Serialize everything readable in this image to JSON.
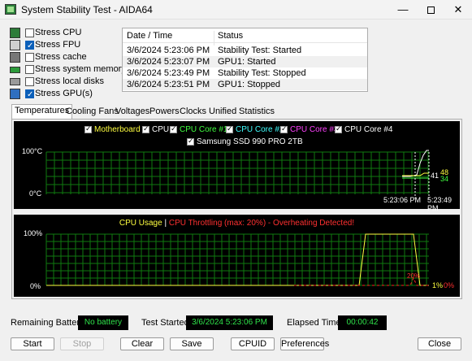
{
  "window": {
    "title": "System Stability Test - AIDA64",
    "minimize": "—",
    "close": "✕"
  },
  "stress": [
    {
      "label": "Stress CPU",
      "checked": false,
      "icon": "cpu-chip-icon",
      "color": "#2d7c3a"
    },
    {
      "label": "Stress FPU",
      "checked": true,
      "icon": "fpu-icon",
      "color": "#5f5f5f"
    },
    {
      "label": "Stress cache",
      "checked": false,
      "icon": "cache-icon",
      "color": "#6c6c6c"
    },
    {
      "label": "Stress system memory",
      "checked": false,
      "icon": "memory-icon",
      "color": "#2c9b3b"
    },
    {
      "label": "Stress local disks",
      "checked": false,
      "icon": "disk-icon",
      "color": "#8a8a8a"
    },
    {
      "label": "Stress GPU(s)",
      "checked": true,
      "icon": "gpu-icon",
      "color": "#2f6fc0"
    }
  ],
  "log": {
    "headers": [
      "Date / Time",
      "Status"
    ],
    "rows": [
      [
        "3/6/2024 5:23:06 PM",
        "Stability Test: Started"
      ],
      [
        "3/6/2024 5:23:07 PM",
        "GPU1: Started"
      ],
      [
        "3/6/2024 5:23:49 PM",
        "Stability Test: Stopped"
      ],
      [
        "3/6/2024 5:23:51 PM",
        "GPU1: Stopped"
      ]
    ]
  },
  "tabs": [
    "Temperatures",
    "Cooling Fans",
    "Voltages",
    "Powers",
    "Clocks",
    "Unified",
    "Statistics"
  ],
  "temp_graph": {
    "legend": [
      {
        "label": "Motherboard",
        "color": "#ffff40"
      },
      {
        "label": "CPU",
        "color": "#ffffff"
      },
      {
        "label": "CPU Core #1",
        "color": "#40ff40"
      },
      {
        "label": "CPU Core #2",
        "color": "#40ffff"
      },
      {
        "label": "CPU Core #3",
        "color": "#ff40ff"
      },
      {
        "label": "CPU Core #4",
        "color": "#ffffff"
      },
      {
        "label": "Samsung SSD 990 PRO 2TB",
        "color": "#ffffff"
      }
    ],
    "ymax_label": "100°C",
    "ymin_label": "0°C",
    "time_labels": [
      "5:23:06 PM",
      "5:23:49 PM"
    ],
    "values_right": [
      "41",
      "48",
      "34"
    ]
  },
  "usage_graph": {
    "title_usage": "CPU Usage",
    "title_sep": "|",
    "title_throttle": "CPU Throttling (max: 20%) - Overheating Detected!",
    "ymax_label": "100%",
    "ymin_label": "0%",
    "value_usage": "1%",
    "value_throttle": "0%",
    "throttle_peak": "20%",
    "usage_color": "#ffff40",
    "throttle_color": "#ff2020"
  },
  "status": {
    "battery_label": "Remaining Battery:",
    "battery_value": "No battery",
    "started_label": "Test Started:",
    "started_value": "3/6/2024 5:23:06 PM",
    "elapsed_label": "Elapsed Time:",
    "elapsed_value": "00:00:42"
  },
  "buttons": {
    "start": "Start",
    "stop": "Stop",
    "clear": "Clear",
    "save": "Save",
    "cpuid": "CPUID",
    "preferences": "Preferences",
    "close": "Close"
  }
}
